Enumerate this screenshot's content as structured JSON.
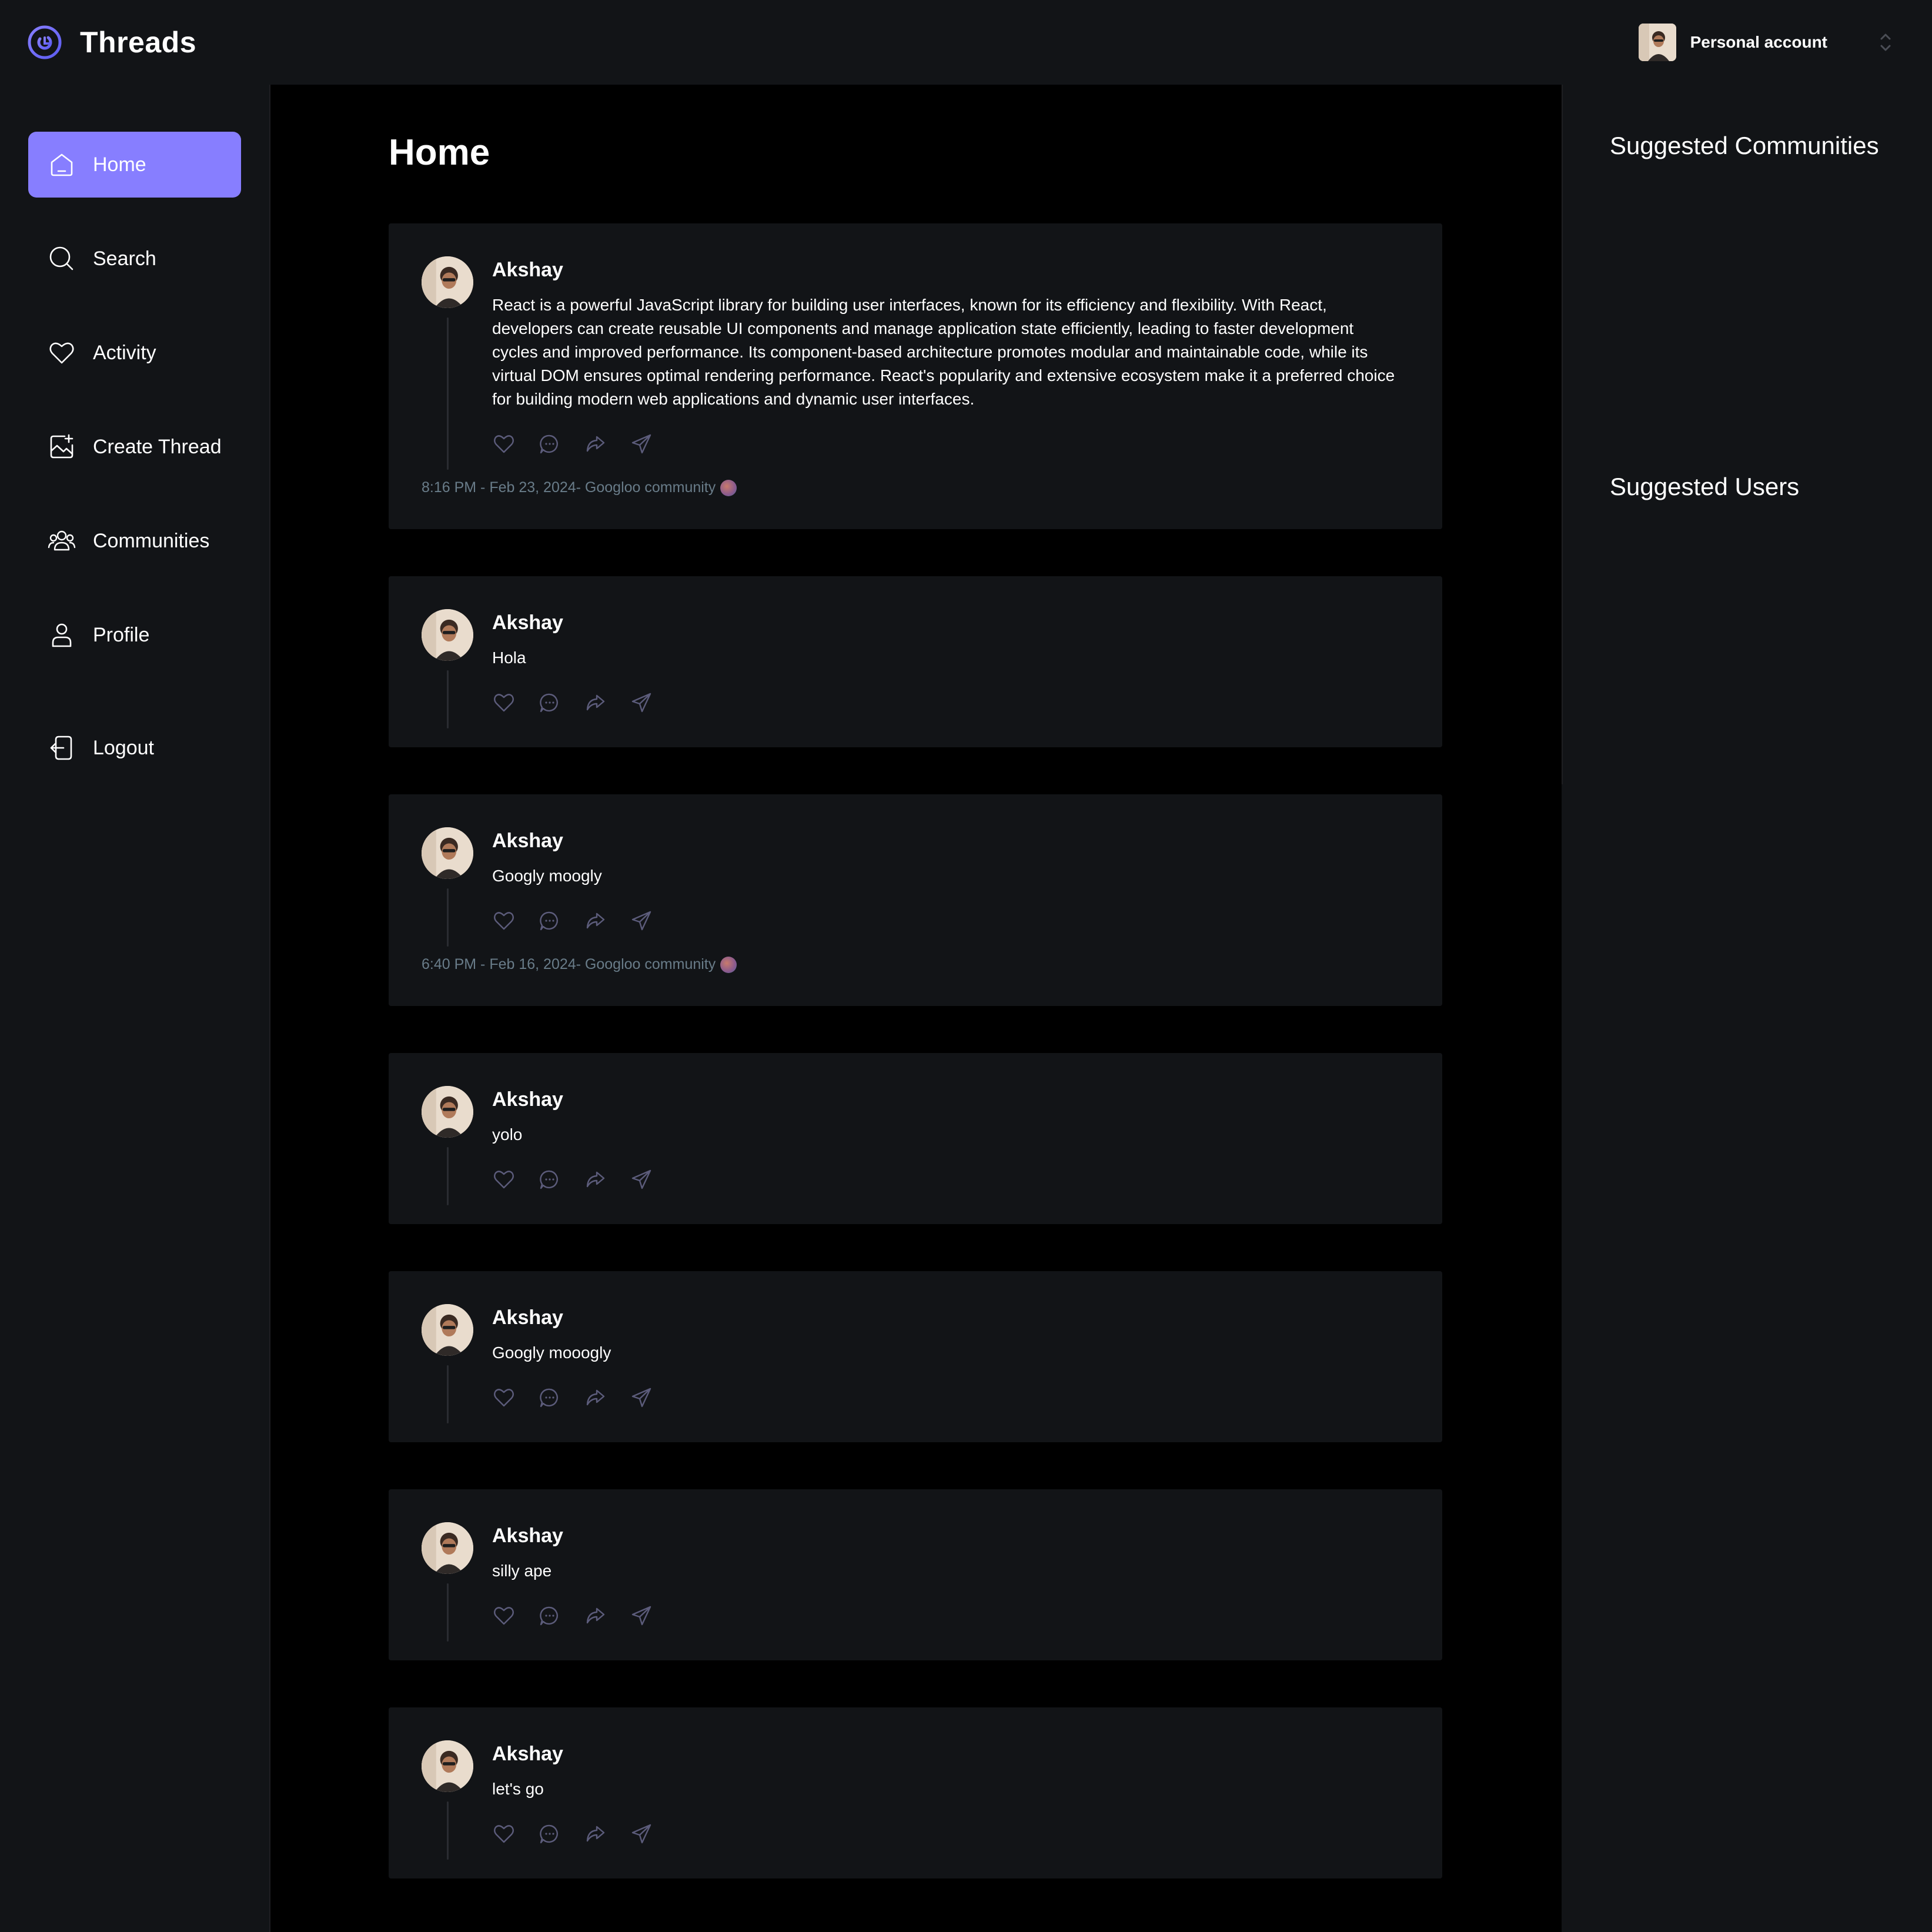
{
  "app": {
    "title": "Threads",
    "brand_color": "#877eff"
  },
  "account": {
    "label": "Personal account"
  },
  "sidebar": {
    "items": [
      {
        "label": "Home",
        "icon": "home-icon",
        "active": true
      },
      {
        "label": "Search",
        "icon": "search-icon",
        "active": false
      },
      {
        "label": "Activity",
        "icon": "heart-icon",
        "active": false
      },
      {
        "label": "Create Thread",
        "icon": "create-image-icon",
        "active": false
      },
      {
        "label": "Communities",
        "icon": "users-icon",
        "active": false
      },
      {
        "label": "Profile",
        "icon": "user-icon",
        "active": false
      }
    ],
    "logout_label": "Logout"
  },
  "main": {
    "title": "Home",
    "posts": [
      {
        "author": "Akshay",
        "text": "React is a powerful JavaScript library for building user interfaces, known for its efficiency and flexibility. With React, developers can create reusable UI components and manage application state efficiently, leading to faster development cycles and improved performance. Its component-based architecture promotes modular and maintainable code, while its virtual DOM ensures optimal rendering performance. React's popularity and extensive ecosystem make it a preferred choice for building modern web applications and dynamic user interfaces.",
        "meta": "8:16 PM - Feb 23, 2024- Googloo community"
      },
      {
        "author": "Akshay",
        "text": "Hola",
        "meta": ""
      },
      {
        "author": "Akshay",
        "text": "Googly moogly",
        "meta": "6:40 PM - Feb 16, 2024- Googloo community"
      },
      {
        "author": "Akshay",
        "text": "yolo",
        "meta": ""
      },
      {
        "author": "Akshay",
        "text": "Googly mooogly",
        "meta": ""
      },
      {
        "author": "Akshay",
        "text": "silly ape",
        "meta": ""
      },
      {
        "author": "Akshay",
        "text": "let's go",
        "meta": ""
      }
    ]
  },
  "rightbar": {
    "suggested_communities": "Suggested Communities",
    "suggested_users": "Suggested Users"
  }
}
